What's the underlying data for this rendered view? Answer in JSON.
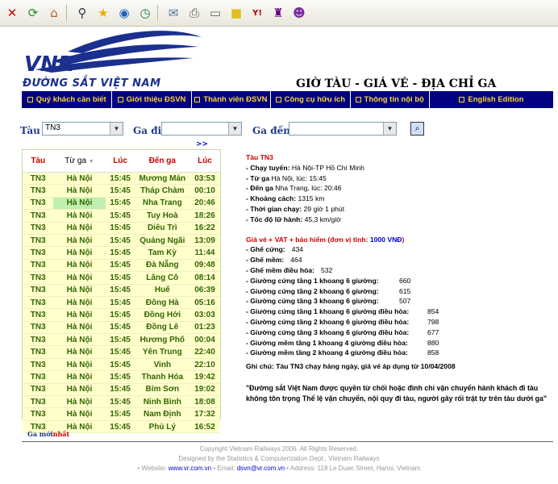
{
  "toolbar": {
    "icons": [
      "close-icon",
      "refresh-icon",
      "home-icon",
      "search-icon",
      "favorites-icon",
      "media-icon",
      "history-icon",
      "mail-icon",
      "print-icon",
      "edit-icon",
      "discuss-icon",
      "yahoo-icon",
      "messenger-icon",
      "yahoo-smiley-icon"
    ]
  },
  "logo": {
    "mark": "VNR",
    "text": "ĐƯỜNG SẮT VIỆT NAM"
  },
  "page_title": "GIỜ TÀU - GIÁ VÉ - ĐỊA CHỈ GA",
  "nav": [
    {
      "label": "Quý khách cần biết"
    },
    {
      "label": "Giới thiệu ĐSVN"
    },
    {
      "label": "Thành viên ĐSVN"
    },
    {
      "label": "Công cụ hữu ích"
    },
    {
      "label": "Thông tin nội bộ"
    },
    {
      "label": "English Edition"
    }
  ],
  "form": {
    "train_label": "Tàu",
    "train_value": "TN3",
    "from_label": "Ga đi",
    "from_value": "",
    "to_label": "Ga đến",
    "to_value": "",
    "more": ">>"
  },
  "table": {
    "headers": [
      "Tàu",
      "Từ ga",
      "Lúc",
      "Đến ga",
      "Lúc"
    ],
    "rows": [
      [
        "TN3",
        "Hà Nội",
        "15:45",
        "Mương Mán",
        "03:53"
      ],
      [
        "TN3",
        "Hà Nội",
        "15:45",
        "Tháp Chàm",
        "00:10"
      ],
      [
        "TN3",
        "Hà Nội",
        "15:45",
        "Nha Trang",
        "20:46"
      ],
      [
        "TN3",
        "Hà Nội",
        "15:45",
        "Tuy Hoà",
        "18:26"
      ],
      [
        "TN3",
        "Hà Nội",
        "15:45",
        "Diêu Trì",
        "16:22"
      ],
      [
        "TN3",
        "Hà Nội",
        "15:45",
        "Quảng Ngãi",
        "13:09"
      ],
      [
        "TN3",
        "Hà Nội",
        "15:45",
        "Tam Kỳ",
        "11:44"
      ],
      [
        "TN3",
        "Hà Nội",
        "15:45",
        "Đà Nẵng",
        "09:48"
      ],
      [
        "TN3",
        "Hà Nội",
        "15:45",
        "Lăng Cô",
        "08:14"
      ],
      [
        "TN3",
        "Hà Nội",
        "15:45",
        "Huế",
        "06:39"
      ],
      [
        "TN3",
        "Hà Nội",
        "15:45",
        "Đông Hà",
        "05:16"
      ],
      [
        "TN3",
        "Hà Nội",
        "15:45",
        "Đồng Hới",
        "03:03"
      ],
      [
        "TN3",
        "Hà Nội",
        "15:45",
        "Đồng Lê",
        "01:23"
      ],
      [
        "TN3",
        "Hà Nội",
        "15:45",
        "Hương Phố",
        "00:04"
      ],
      [
        "TN3",
        "Hà Nội",
        "15:45",
        "Yên Trung",
        "22:40"
      ],
      [
        "TN3",
        "Hà Nội",
        "15:45",
        "Vinh",
        "22:10"
      ],
      [
        "TN3",
        "Hà Nội",
        "15:45",
        "Thanh Hóa",
        "19:42"
      ],
      [
        "TN3",
        "Hà Nội",
        "15:45",
        "Bỉm Sơn",
        "19:02"
      ],
      [
        "TN3",
        "Hà Nội",
        "15:45",
        "Ninh Bình",
        "18:08"
      ],
      [
        "TN3",
        "Hà Nội",
        "15:45",
        "Nam Định",
        "17:32"
      ],
      [
        "TN3",
        "Hà Nội",
        "15:45",
        "Phủ Lý",
        "16:52"
      ]
    ]
  },
  "info": {
    "title": "Tàu TN3",
    "details": [
      {
        "k": "- Chạy tuyến:",
        "v": " Hà Nội-TP Hồ Chí Minh"
      },
      {
        "k": "- Từ ga",
        "v": " Hà Nội, lúc: 15:45"
      },
      {
        "k": "- Đến ga",
        "v": " Nha Trang, lúc: 20:46"
      },
      {
        "k": "- Khoảng cách:",
        "v": " 1315 km"
      },
      {
        "k": "- Thời gian chạy:",
        "v": " 29 giờ 1 phút"
      },
      {
        "k": "- Tốc độ lữ hành:",
        "v": " 45,3 km/giờ"
      }
    ],
    "price_title": "Giá vé + VAT + bảo hiểm (đơn vị tính: ",
    "price_unit": "1000 VNĐ",
    "price_close": ")",
    "prices": [
      {
        "k": "- Ghế cứng:",
        "v": "434"
      },
      {
        "k": "- Ghế mềm:",
        "v": "464"
      },
      {
        "k": "- Ghế mềm điều hòa:",
        "v": "532"
      },
      {
        "k": "- Giường cứng tầng 1 khoang 6 giường:",
        "v": "660"
      },
      {
        "k": "- Giường cứng tầng 2 khoang 6 giường:",
        "v": "615"
      },
      {
        "k": "- Giường cứng tầng 3 khoang 6 giường:",
        "v": "507"
      },
      {
        "k": "- Giường cứng tầng 1 khoang 6 giường điều hòa:",
        "v": "854"
      },
      {
        "k": "- Giường cứng tầng 2 khoang 6 giường điều hòa:",
        "v": "798"
      },
      {
        "k": "- Giường cứng tầng 3 khoang 6 giường điều hòa:",
        "v": "677"
      },
      {
        "k": "- Giường mềm tầng 1 khoang 4 giường điều hòa:",
        "v": "880"
      },
      {
        "k": "- Giường mềm tầng 2 khoang 4 giường điều hòa:",
        "v": "858"
      }
    ],
    "note": "Ghi chú: Tàu TN3 chạy hàng ngày, giá vé áp dụng từ 10/04/2008",
    "quote": "\"Đường sắt Việt Nam được quyền từ chối hoặc đình chỉ vận chuyển hành khách đi tàu không tôn trọng Thể lệ vận chuyển, nội quy đi tàu, người gây rối trật tự trên tàu dưới ga\""
  },
  "ga_link": {
    "main": "Ga mới",
    "red": "nhất"
  },
  "footer": {
    "copyright": "Copyright Vietnam Railways 2006. All Rights Reserved.",
    "designed": "Designed by the Statistics & Computerization Dept., Vietnam Railways",
    "website_label": "• Website: ",
    "website": "www.vr.com.vn",
    "email_label": " • Email: ",
    "email": "dsvn@vr.com.vn",
    "address": " • Address: 118 Le Duan Street, Hanoi, Vietnam"
  },
  "colors": {
    "nav_bg": "#000080",
    "nav_text": "#ffd633",
    "accent_red": "#cc0000",
    "schedule_bg": "#ffffcc",
    "schedule_text": "#336600"
  }
}
